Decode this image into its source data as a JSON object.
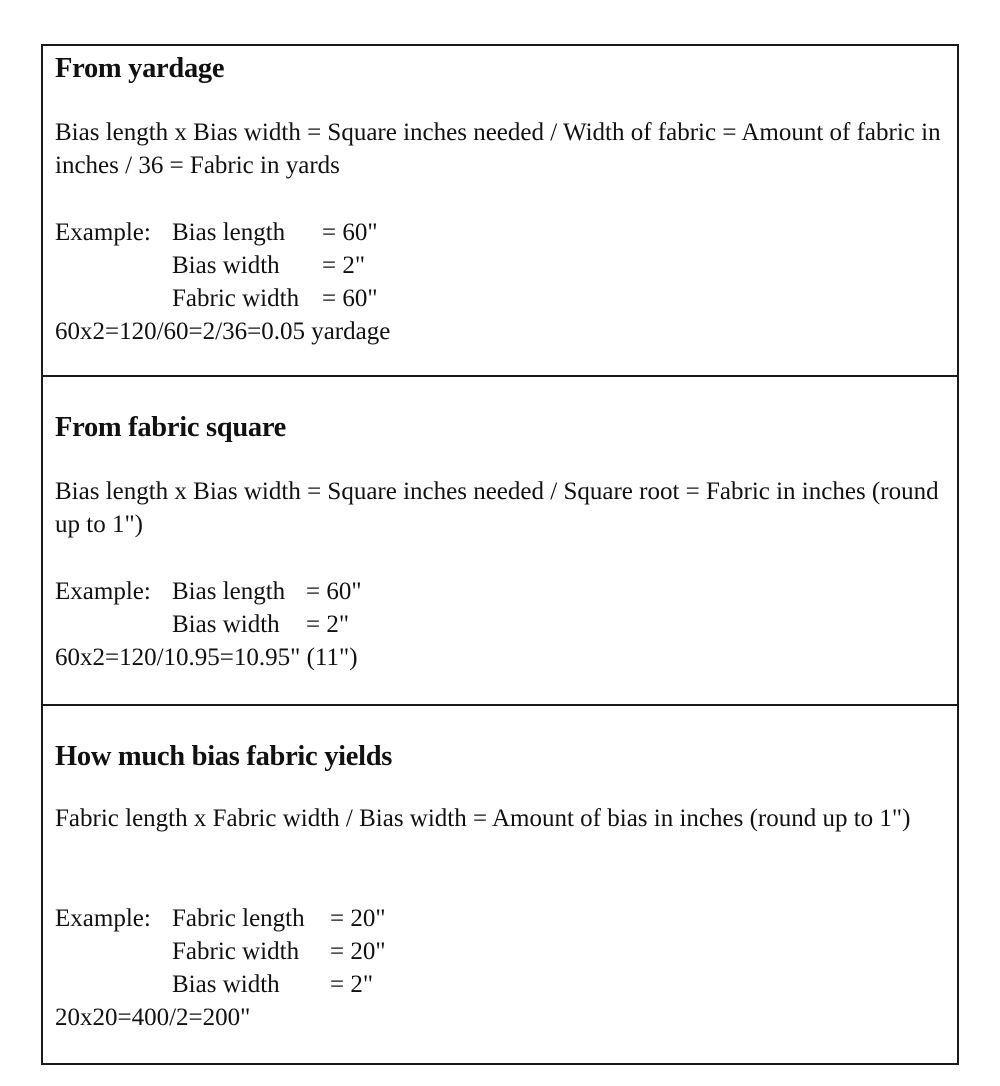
{
  "sections": [
    {
      "heading": "From yardage",
      "formula": "Bias length x Bias width = Square inches needed / Width of fabric = Amount of fabric in inches / 36 = Fabric in yards",
      "example_label": "Example:",
      "example_lines": [
        {
          "name": "Bias length",
          "value": "= 60\""
        },
        {
          "name": "Bias width",
          "value": "= 2\""
        },
        {
          "name": "Fabric width",
          "value": "= 60\""
        }
      ],
      "result": "60x2=120/60=2/36=0.05 yardage"
    },
    {
      "heading": "From fabric square",
      "formula": "Bias length x Bias width = Square inches needed / Square root = Fabric in inches (round up to 1\")",
      "example_label": "Example:",
      "example_lines": [
        {
          "name": "Bias length",
          "value": "= 60\""
        },
        {
          "name": "Bias width",
          "value": "= 2\""
        }
      ],
      "result": "60x2=120/10.95=10.95\" (11\")"
    },
    {
      "heading": "How much bias fabric yields",
      "formula": "Fabric length x Fabric width / Bias width = Amount of bias in inches (round up to 1\")",
      "example_label": "Example:",
      "example_lines": [
        {
          "name": "Fabric length",
          "value": "= 20\""
        },
        {
          "name": "Fabric width",
          "value": "= 20\""
        },
        {
          "name": "Bias width",
          "value": "= 2\""
        }
      ],
      "result": "20x20=400/2=200\""
    }
  ]
}
